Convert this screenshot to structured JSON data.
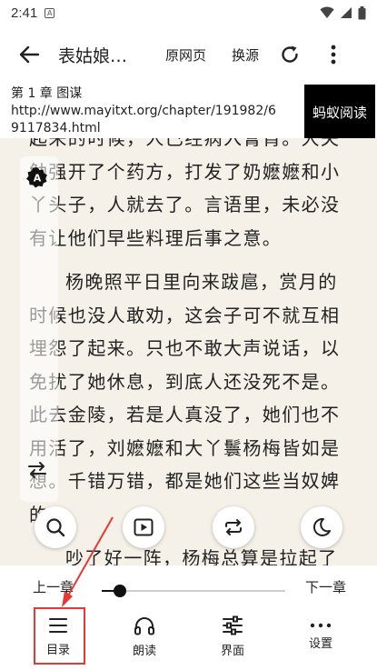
{
  "status_bar": {
    "time": "2:41",
    "notification": "A"
  },
  "app_bar": {
    "title": "表姑娘…",
    "original_page": "原网页",
    "change_source": "换源"
  },
  "chapter": {
    "title": "第 1 章 图谋",
    "url": "http://www.mayitxt.org/chapter/191982/69117834.html",
    "source_name": "蚂蚁阅读"
  },
  "reader": {
    "paragraphs": [
      "起来的时候，人已经病入膏肓。大夫",
      "勉强开了个药方，打发了奶嬷嬷和小",
      "丫头子，人就去了。言语里，未必没",
      "有让他们早些料理后事之意。",
      "杨晚照平日里向来跋扈，赏月的",
      "时候也没人敢劝，这会子可不就互相",
      "埋怨了起来。只也不敢大声说话，以",
      "免扰了她休息，到底人还没死不是。",
      "此去金陵，若是人真没了，她们也不",
      "用活了，刘嬷嬷和大丫鬟杨梅皆如是",
      "想。千错万错，都是她们这些当奴婢",
      "的",
      "吵了好一阵，杨梅总算是拉起了"
    ]
  },
  "bottom": {
    "prev_chapter": "上一章",
    "next_chapter": "下一章",
    "progress": 0.1,
    "tabs": [
      {
        "label": "目录",
        "icon": "menu-icon"
      },
      {
        "label": "朗读",
        "icon": "headphones-icon"
      },
      {
        "label": "界面",
        "icon": "sliders-icon"
      },
      {
        "label": "设置",
        "icon": "more-icon"
      }
    ]
  }
}
